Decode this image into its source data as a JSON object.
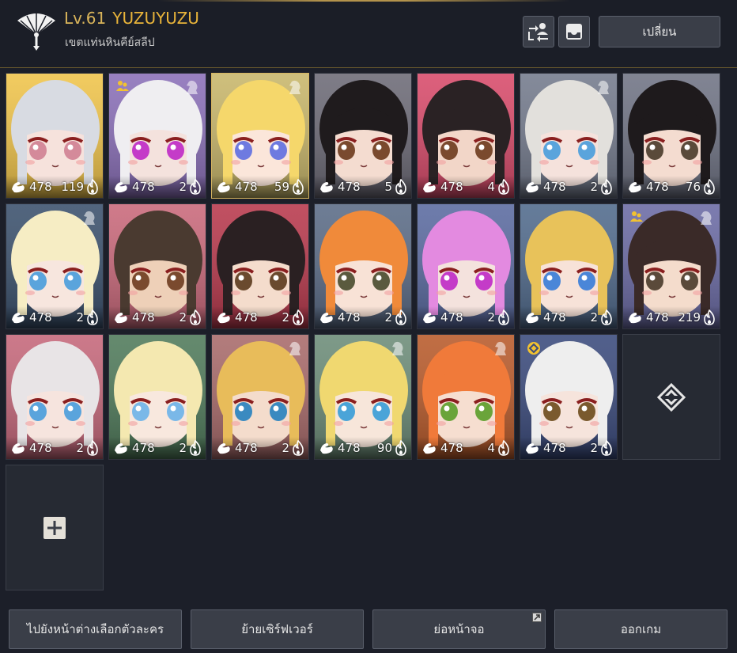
{
  "header": {
    "level": "Lv.61",
    "player_name": "YUZUYUZU",
    "server": "เขตแท่นหินคีย์สลีป",
    "change_button": "เปลี่ยน",
    "icons": [
      "fan-emblem-icon",
      "swap-characters-icon",
      "inbox-icon"
    ]
  },
  "characters": [
    {
      "power": "478",
      "count": "119",
      "bg": "#f0c44a",
      "hair": "#d8dbe2",
      "eye": "#d48a9a",
      "skin": "#f6e2dc"
    },
    {
      "power": "478",
      "count": "2",
      "bg": "#8a6fb8",
      "hair": "#efeef1",
      "eye": "#c43bc8",
      "skin": "#f4e2dd",
      "party": true,
      "knight": true
    },
    {
      "power": "478",
      "count": "59",
      "bg": "#c8b66a",
      "hair": "#f5d76b",
      "eye": "#6e7ae0",
      "skin": "#fbe6da",
      "selected": true,
      "knight": true
    },
    {
      "power": "478",
      "count": "5",
      "bg": "#6c6a76",
      "hair": "#1f1b1d",
      "eye": "#7a4a2e",
      "skin": "#f4dcd0"
    },
    {
      "power": "478",
      "count": "4",
      "bg": "#d84a6a",
      "hair": "#2a2224",
      "eye": "#7a4a2e",
      "skin": "#f2d6c8"
    },
    {
      "power": "478",
      "count": "2",
      "bg": "#737a8c",
      "hair": "#e2e0dc",
      "eye": "#5aa4dc",
      "skin": "#f5e2dc",
      "knight": true
    },
    {
      "power": "478",
      "count": "76",
      "bg": "#6f7384",
      "hair": "#1e1a1c",
      "eye": "#5a4a3a",
      "skin": "#f4dcd0"
    },
    {
      "power": "478",
      "count": "2",
      "bg": "#3a506c",
      "hair": "#f6edc4",
      "eye": "#5aa4dc",
      "skin": "#f7e6de",
      "knight": true
    },
    {
      "power": "478",
      "count": "2",
      "bg": "#c9687a",
      "hair": "#4a3a30",
      "eye": "#7a4a2e",
      "skin": "#eed0b8"
    },
    {
      "power": "478",
      "count": "2",
      "bg": "#b8384c",
      "hair": "#2a2022",
      "eye": "#6a4a2e",
      "skin": "#f4dccc"
    },
    {
      "power": "478",
      "count": "2",
      "bg": "#5a6b86",
      "hair": "#f08a3a",
      "eye": "#5a5a3e",
      "skin": "#f8e2d6"
    },
    {
      "power": "478",
      "count": "2",
      "bg": "#5a6aa0",
      "hair": "#e38ae0",
      "eye": "#c43bc8",
      "skin": "#f4e2dd"
    },
    {
      "power": "478",
      "count": "2",
      "bg": "#506a8c",
      "hair": "#e8c25a",
      "eye": "#4a86d8",
      "skin": "#f7e2d8"
    },
    {
      "power": "478",
      "count": "219",
      "bg": "#6a6aa4",
      "hair": "#3a2a28",
      "eye": "#5a4a3a",
      "skin": "#f4dccc",
      "party": true,
      "knight": true
    },
    {
      "power": "478",
      "count": "2",
      "bg": "#c5677a",
      "hair": "#e8e4e6",
      "eye": "#5aa4dc",
      "skin": "#f6e4de"
    },
    {
      "power": "478",
      "count": "2",
      "bg": "#4f7a5a",
      "hair": "#f4e8b0",
      "eye": "#7ab8e8",
      "skin": "#f8e8de"
    },
    {
      "power": "478",
      "count": "2",
      "bg": "#a86a6a",
      "hair": "#e8bc5a",
      "eye": "#3a8ac0",
      "skin": "#f4dccc",
      "knight": true
    },
    {
      "power": "478",
      "count": "90",
      "bg": "#6c8c78",
      "hair": "#f0d870",
      "eye": "#4aa4d8",
      "skin": "#f7e6da",
      "knight": true
    },
    {
      "power": "478",
      "count": "4",
      "bg": "#b85a2a",
      "hair": "#f07a3a",
      "eye": "#6aa43a",
      "skin": "#f6ded0",
      "knight": true
    },
    {
      "power": "478",
      "count": "2",
      "bg": "#3a4a7c",
      "hair": "#eeeeee",
      "eye": "#7a5a2e",
      "skin": "#f6e4dc",
      "pin": true
    }
  ],
  "bottom_buttons": {
    "character_select": "ไปยังหน้าต่างเลือกตัวละคร",
    "move_server": "ย้ายเซิร์ฟเวอร์",
    "minimize": "ย่อหน้าจอ",
    "exit": "ออกเกม"
  },
  "colors": {
    "gold": "#e9b43a",
    "button_bg": "#3a3e48",
    "panel_bg": "#1c1f29"
  }
}
